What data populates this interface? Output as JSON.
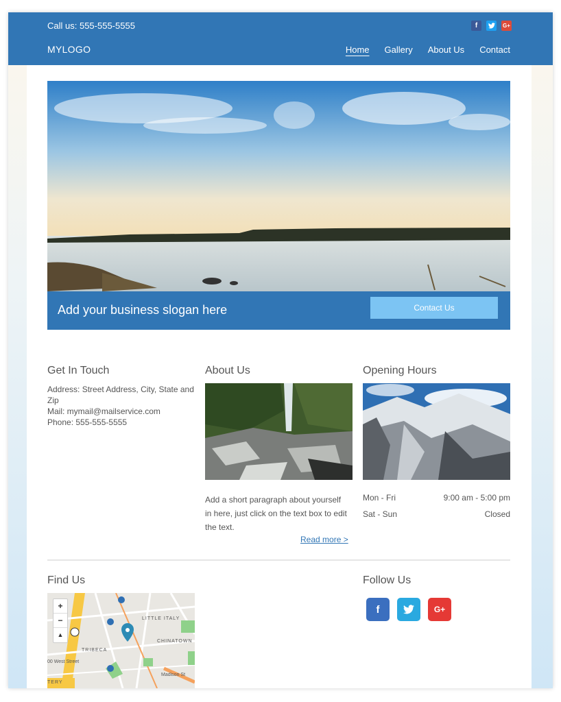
{
  "header": {
    "phone": "Call us: 555-555-5555",
    "logo": "MYLOGO",
    "nav": [
      {
        "label": "Home"
      },
      {
        "label": "Gallery"
      },
      {
        "label": "About Us"
      },
      {
        "label": "Contact"
      }
    ],
    "social": [
      {
        "icon": "facebook-icon",
        "glyph": "f",
        "color": "#3b5998"
      },
      {
        "icon": "twitter-icon",
        "glyph": "t",
        "color": "#1da1f2"
      },
      {
        "icon": "google-plus-icon",
        "glyph": "G+",
        "color": "#dd4b39"
      }
    ]
  },
  "hero": {
    "slogan": "Add your business slogan here",
    "cta_label": "Contact Us"
  },
  "contact": {
    "title": "Get In Touch",
    "address": "Address: Street Address, City, State and Zip",
    "mail": "Mail: mymail@mailservice.com",
    "phone": "Phone: 555-555-5555"
  },
  "about": {
    "title": "About Us",
    "text": "Add a short paragraph about yourself in here, just click on the text box to edit the text.",
    "read_more": "Read more >"
  },
  "hours": {
    "title": "Opening Hours",
    "rows": [
      {
        "day": "Mon - Fri",
        "time": "9:00 am - 5:00 pm"
      },
      {
        "day": "Sat - Sun",
        "time": "Closed"
      }
    ]
  },
  "find": {
    "title": "Find Us",
    "map_labels": [
      "LITTLE ITALY",
      "CHINATOWN",
      "TRIBECA",
      "00 West Street",
      "Madison St",
      "TERY"
    ],
    "zoom": [
      "+",
      "−",
      "▲"
    ]
  },
  "follow": {
    "title": "Follow Us",
    "icons": [
      {
        "icon": "facebook-icon",
        "glyph": "f",
        "color": "#3b6fbf"
      },
      {
        "icon": "twitter-icon",
        "glyph": "t",
        "color": "#2aa9e0"
      },
      {
        "icon": "google-plus-icon",
        "glyph": "G+",
        "color": "#e53935"
      }
    ]
  },
  "colors": {
    "brand": "#3176b5",
    "cta": "#7cc4f3"
  }
}
